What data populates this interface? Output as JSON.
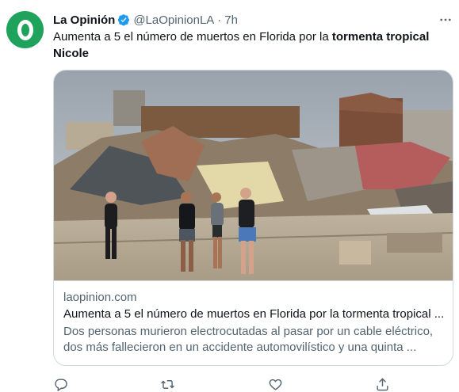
{
  "author": {
    "name": "La Opinión",
    "handle": "@LaOpinionLA",
    "separator": "·",
    "time": "7h",
    "verified": true
  },
  "tweet": {
    "text_plain": "Aumenta a 5 el número de muertos en Florida por la ",
    "text_bold": "tormenta tropical Nicole"
  },
  "card": {
    "image_description": "people walking past collapsed houses and debris",
    "domain": "laopinion.com",
    "title": "Aumenta a 5 el número de muertos en Florida por la tormenta tropical ...",
    "description": "Dos personas murieron electrocutadas al pasar por un cable eléctrico, dos más fallecieron en un accidente automovilístico y una quinta ..."
  },
  "actions": [
    {
      "icon": "reply-icon"
    },
    {
      "icon": "retweet-icon"
    },
    {
      "icon": "like-icon"
    },
    {
      "icon": "share-icon"
    }
  ],
  "colors": {
    "avatar": "#1fa35c",
    "verified": "#1d9bf0",
    "secondary_text": "#536471",
    "border": "#cfd9de"
  }
}
